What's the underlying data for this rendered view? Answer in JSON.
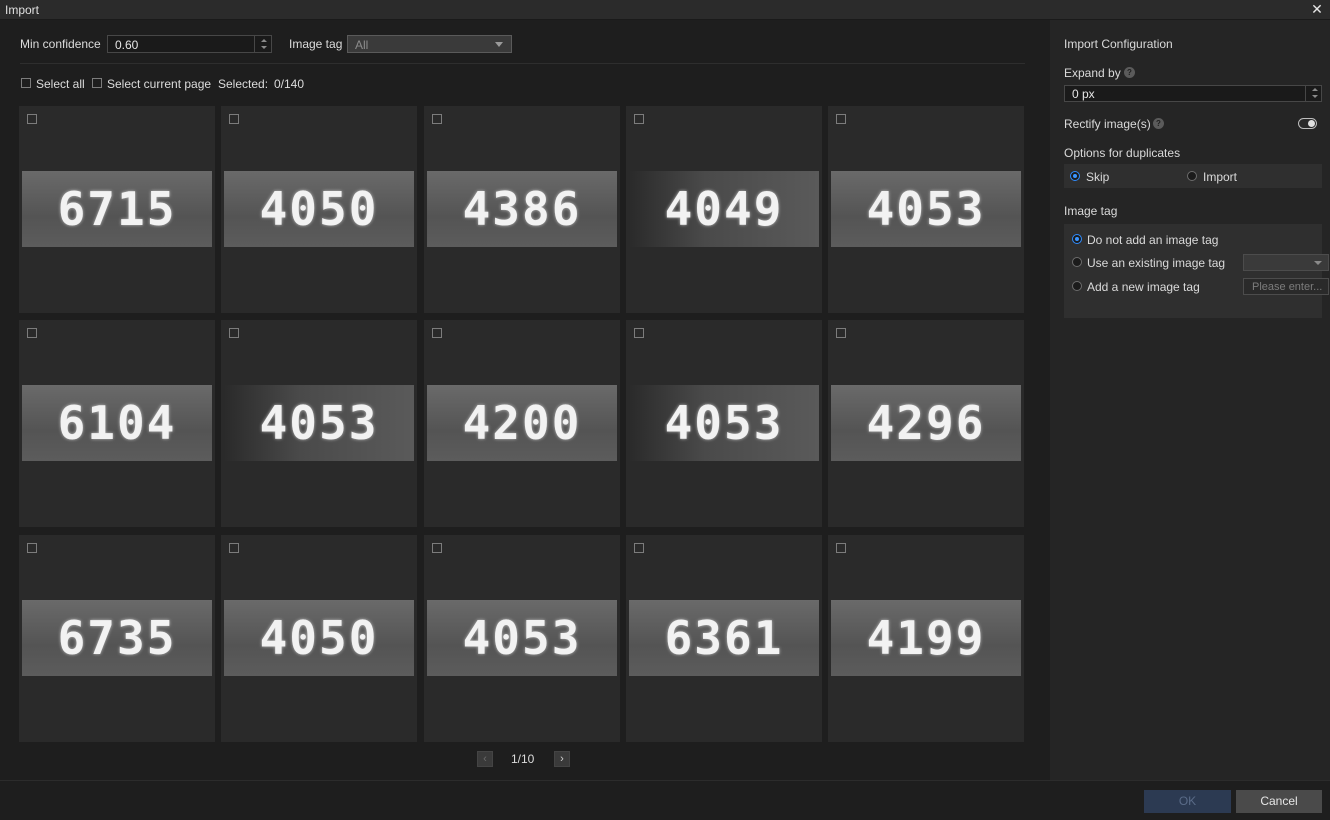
{
  "window": {
    "title": "Import"
  },
  "filters": {
    "min_confidence_label": "Min confidence",
    "min_confidence_value": "0.60",
    "image_tag_label": "Image tag",
    "image_tag_value": "All"
  },
  "selection": {
    "select_all_label": "Select all",
    "select_page_label": "Select current page",
    "selected_label": "Selected:",
    "selected_count": "0/140"
  },
  "images": [
    {
      "digits": "6715",
      "dark": false
    },
    {
      "digits": "4050",
      "dark": false
    },
    {
      "digits": "4386",
      "dark": false
    },
    {
      "digits": "4049",
      "dark": true
    },
    {
      "digits": "4053",
      "dark": false
    },
    {
      "digits": "6104",
      "dark": false
    },
    {
      "digits": "4053",
      "dark": true
    },
    {
      "digits": "4200",
      "dark": false
    },
    {
      "digits": "4053",
      "dark": true
    },
    {
      "digits": "4296",
      "dark": false
    },
    {
      "digits": "6735",
      "dark": false
    },
    {
      "digits": "4050",
      "dark": false
    },
    {
      "digits": "4053",
      "dark": false
    },
    {
      "digits": "6361",
      "dark": false
    },
    {
      "digits": "4199",
      "dark": false
    }
  ],
  "pagination": {
    "prev": "‹",
    "next": "›",
    "text": "1/10"
  },
  "config": {
    "title": "Import Configuration",
    "expand_label": "Expand by",
    "expand_value": "0 px",
    "rectify_label": "Rectify image(s)",
    "rectify_on": false,
    "duplicates_label": "Options for duplicates",
    "dup_skip": "Skip",
    "dup_import": "Import",
    "image_tag_title": "Image tag",
    "tag_opt_none": "Do not add an image tag",
    "tag_opt_existing": "Use an existing image tag",
    "tag_opt_new": "Add a new image tag",
    "new_tag_placeholder": "Please enter...",
    "help_glyph": "?"
  },
  "footer": {
    "ok": "OK",
    "cancel": "Cancel"
  },
  "colors": {
    "accent": "#2f8cff",
    "ok_disabled_bg": "#2c3a52"
  }
}
